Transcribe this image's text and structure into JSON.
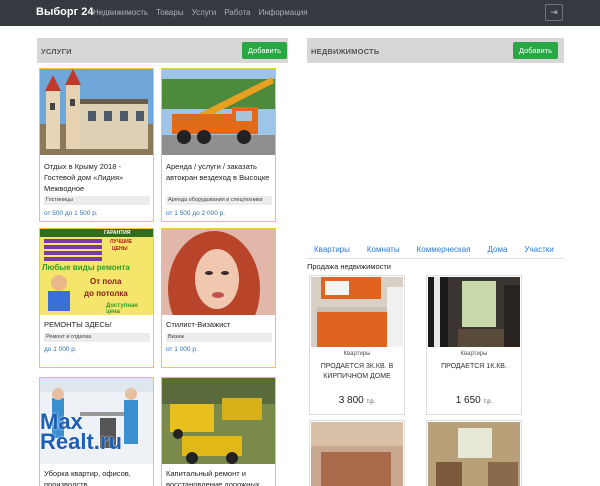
{
  "navbar": {
    "brand": "Выборг 24",
    "links": [
      "Недвижимость",
      "Товары",
      "Услуги",
      "Работа",
      "Информация"
    ],
    "login_icon": "login-icon"
  },
  "services": {
    "title": "УСЛУГИ",
    "add_label": "Добавить",
    "cards": [
      {
        "title": "Отдых в Крыму 2018 - Гостевой дом «Лидия» Межводное",
        "category": "Гостиницы",
        "price": "от 500 до 1 500 р."
      },
      {
        "title": "Аренда / услуги / заказать автокран вездеход в Высоцке",
        "category": "Аренда оборудования и спецтехники",
        "price": "от 1 500 до 2 000 р."
      },
      {
        "title": "РЕМОНТЫ ЗДЕСЬ!",
        "category": "Ремонт и отделка",
        "price": "до 1 000 р.",
        "ad_text": {
          "top": "ГАРАНТИЯ",
          "best": "ЛУЧШИЕ",
          "prices": "ЦЕНЫ",
          "main": "Любые виды ремонта",
          "from": "От пола",
          "to": "до потолка",
          "cheap": "Доступная цена"
        }
      },
      {
        "title": "Стилист-Визажист",
        "category": "Визаж",
        "price": "от 1 000 р."
      },
      {
        "title": "Уборка квартир, офисов, производств",
        "category": "",
        "price": ""
      },
      {
        "title": "Капитальный ремонт и восстановление дорожных",
        "category": "",
        "price": ""
      }
    ]
  },
  "realty": {
    "title": "НЕДВИЖИМОСТЬ",
    "add_label": "Добавить",
    "tabs": [
      "Квартиры",
      "Комнаты",
      "Коммерческая",
      "Дома",
      "Участки"
    ],
    "sale_title": "Продажа недвижимости",
    "cards": [
      {
        "type": "Квартиры",
        "desc": "ПРОДАЕТСЯ 3К.КВ. В КИРПИЧНОМ ДОМЕ",
        "price": "3 800",
        "unit": "т.р."
      },
      {
        "type": "Квартиры",
        "desc": "ПРОДАЕТСЯ 1К.КВ.",
        "price": "1 650",
        "unit": "т.р."
      }
    ]
  },
  "watermark": {
    "line1": "Max",
    "line2": "Realt.ru"
  }
}
